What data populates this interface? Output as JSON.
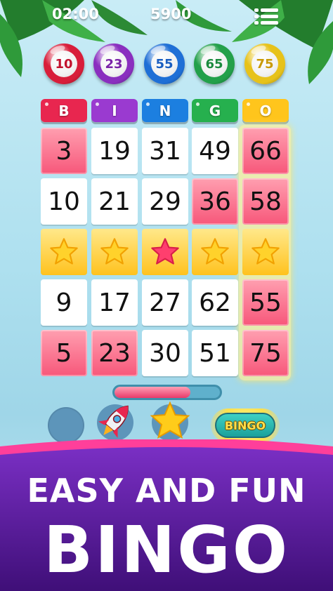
{
  "hud": {
    "timer": "02:00",
    "score": "5900",
    "menu_icon": "menu-list-icon"
  },
  "called_balls": [
    {
      "number": "10",
      "color": "#d81e3a",
      "text_color": "#c2122e"
    },
    {
      "number": "23",
      "color": "#8a2fbf",
      "text_color": "#7a24a8"
    },
    {
      "number": "55",
      "color": "#1f6fd6",
      "text_color": "#1a5ec0"
    },
    {
      "number": "65",
      "color": "#23a04a",
      "text_color": "#1b8a3e"
    },
    {
      "number": "75",
      "color": "#e7c21a",
      "text_color": "#c99a08"
    }
  ],
  "columns": [
    {
      "letter": "B",
      "color": "#e8264f"
    },
    {
      "letter": "I",
      "color": "#9a3ad0"
    },
    {
      "letter": "N",
      "color": "#1c7fe0"
    },
    {
      "letter": "G",
      "color": "#26b04e"
    },
    {
      "letter": "O",
      "color": "#ffc51c"
    }
  ],
  "grid": [
    [
      {
        "value": "3",
        "state": "marked"
      },
      {
        "value": "19",
        "state": "plain"
      },
      {
        "value": "31",
        "state": "plain"
      },
      {
        "value": "49",
        "state": "plain"
      },
      {
        "value": "66",
        "state": "marked"
      }
    ],
    [
      {
        "value": "10",
        "state": "plain"
      },
      {
        "value": "21",
        "state": "plain"
      },
      {
        "value": "29",
        "state": "plain"
      },
      {
        "value": "36",
        "state": "marked"
      },
      {
        "value": "58",
        "state": "marked"
      }
    ],
    [
      {
        "value": "",
        "state": "star"
      },
      {
        "value": "",
        "state": "star"
      },
      {
        "value": "",
        "state": "free-star"
      },
      {
        "value": "",
        "state": "star"
      },
      {
        "value": "",
        "state": "star"
      }
    ],
    [
      {
        "value": "9",
        "state": "plain"
      },
      {
        "value": "17",
        "state": "plain"
      },
      {
        "value": "27",
        "state": "plain"
      },
      {
        "value": "62",
        "state": "plain"
      },
      {
        "value": "55",
        "state": "marked"
      }
    ],
    [
      {
        "value": "5",
        "state": "marked"
      },
      {
        "value": "23",
        "state": "marked"
      },
      {
        "value": "30",
        "state": "plain"
      },
      {
        "value": "51",
        "state": "plain"
      },
      {
        "value": "75",
        "state": "marked"
      }
    ]
  ],
  "highlighted_column": "O",
  "progress": {
    "fraction": 0.72
  },
  "powerups": [
    {
      "name": "empty-slot-icon"
    },
    {
      "name": "rocket-icon"
    },
    {
      "name": "star-icon"
    }
  ],
  "bingo_button": {
    "label": "BINGO"
  },
  "banner": {
    "line1": "EASY AND FUN",
    "line2": "BINGO"
  },
  "colors": {
    "marked": "#f7577a",
    "star": "#ffc21e",
    "banner_purple": "#5a1f9a",
    "banner_pink": "#ff3f9a"
  }
}
